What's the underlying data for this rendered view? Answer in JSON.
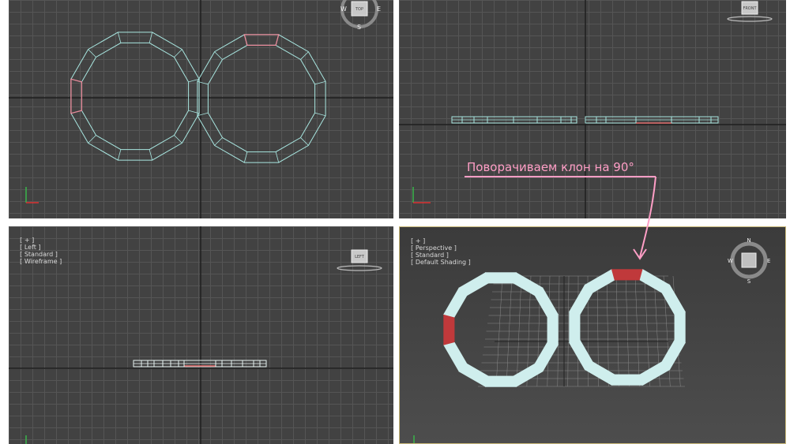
{
  "viewports": {
    "top": {
      "label_parts": []
    },
    "front": {
      "label_parts": []
    },
    "left": {
      "label_parts": [
        "[ + ]",
        "[ Left ]",
        "[ Standard ]",
        "[ Wireframe ]"
      ]
    },
    "perspective": {
      "label_parts": [
        "[ + ]",
        "[ Perspective ]",
        "[ Standard ]",
        "[ Default Shading ]"
      ]
    }
  },
  "viewcube": {
    "top_face": "TOP",
    "front_face": "FRONT",
    "left_face": "LEFT",
    "compass": {
      "n": "N",
      "s": "S",
      "e": "E",
      "w": "W"
    }
  },
  "annotation": {
    "text": "Поворачиваем клон на 90°"
  },
  "colors": {
    "viewport_bg": "#424242",
    "grid": "#555555",
    "grid_axis": "#1e1e1e",
    "wire_cyan": "#a8e6e0",
    "selection_red": "#c0393b",
    "ring_fill": "#cfeeed",
    "annotation_pink": "#ff9ec6",
    "active_border": "#c9b97a"
  },
  "icons": [
    "viewcube-icon",
    "compass-ring-icon",
    "axis-tripod-icon",
    "annotation-arrow-icon"
  ]
}
